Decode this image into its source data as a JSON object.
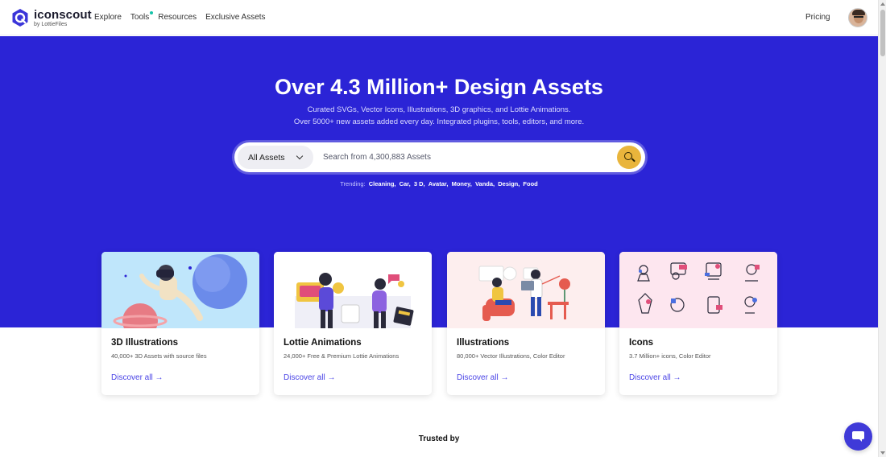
{
  "header": {
    "logo_name": "iconscout",
    "logo_sub": "by LottieFiles",
    "nav": [
      {
        "label": "Explore"
      },
      {
        "label": "Tools"
      },
      {
        "label": "Resources"
      },
      {
        "label": "Exclusive Assets"
      }
    ],
    "pricing": "Pricing"
  },
  "hero": {
    "title": "Over 4.3 Million+ Design Assets",
    "subtitle_line1": "Curated SVGs, Vector Icons, Illustrations, 3D graphics, and Lottie Animations.",
    "subtitle_line2": "Over 5000+ new assets added every day. Integrated plugins, tools, editors, and more.",
    "search": {
      "category": "All Assets",
      "placeholder": "Search from 4,300,883 Assets"
    },
    "trending_label": "Trending:",
    "trending": [
      "Cleaning,",
      "Car,",
      "3 D,",
      "Avatar,",
      "Money,",
      "Vanda,",
      "Design,",
      "Food"
    ]
  },
  "cards": [
    {
      "title": "3D Illustrations",
      "desc": "40,000+ 3D Assets with source files",
      "link": "Discover all →"
    },
    {
      "title": "Lottie Animations",
      "desc": "24,000+ Free & Premium Lottie Animations",
      "link": "Discover all →"
    },
    {
      "title": "Illustrations",
      "desc": "80,000+ Vector Illustrations, Color Editor",
      "link": "Discover all →"
    },
    {
      "title": "Icons",
      "desc": "3.7 Million+ icons, Color Editor",
      "link": "Discover all →"
    }
  ],
  "trusted_by": "Trusted by",
  "colors": {
    "hero_bg": "#2b24d6",
    "accent": "#4b45e6",
    "search_button": "#e9b53c"
  },
  "icons": [
    "logo-icon",
    "chevron-down-icon",
    "search-icon",
    "chat-icon",
    "new-dot-icon"
  ]
}
